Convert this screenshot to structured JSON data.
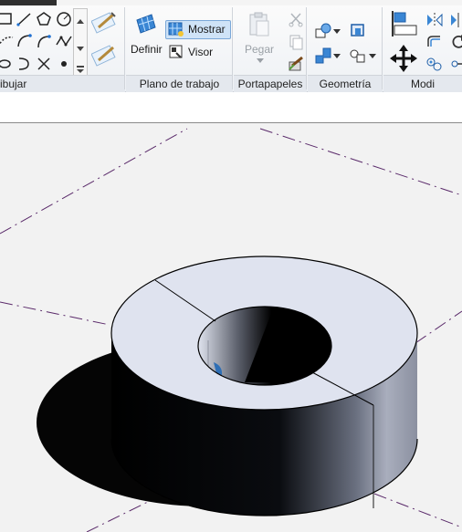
{
  "ribbon": {
    "panels": {
      "dibujar": "ibujar",
      "plano_trabajo": "Plano de trabajo",
      "portapapeles": "Portapapeles",
      "geometria": "Geometría",
      "modificar": "Modi"
    },
    "buttons": {
      "definir": "Definir",
      "mostrar": "Mostrar",
      "visor": "Visor",
      "pegar": "Pegar"
    }
  },
  "colors": {
    "ribbon_bg": "#eef1f5",
    "active_button": "#cfe3f7",
    "viewport_bg": "#f2f2f2",
    "ring_top": "#dfe3ef",
    "workplane_lines": "#5a2a6a"
  }
}
